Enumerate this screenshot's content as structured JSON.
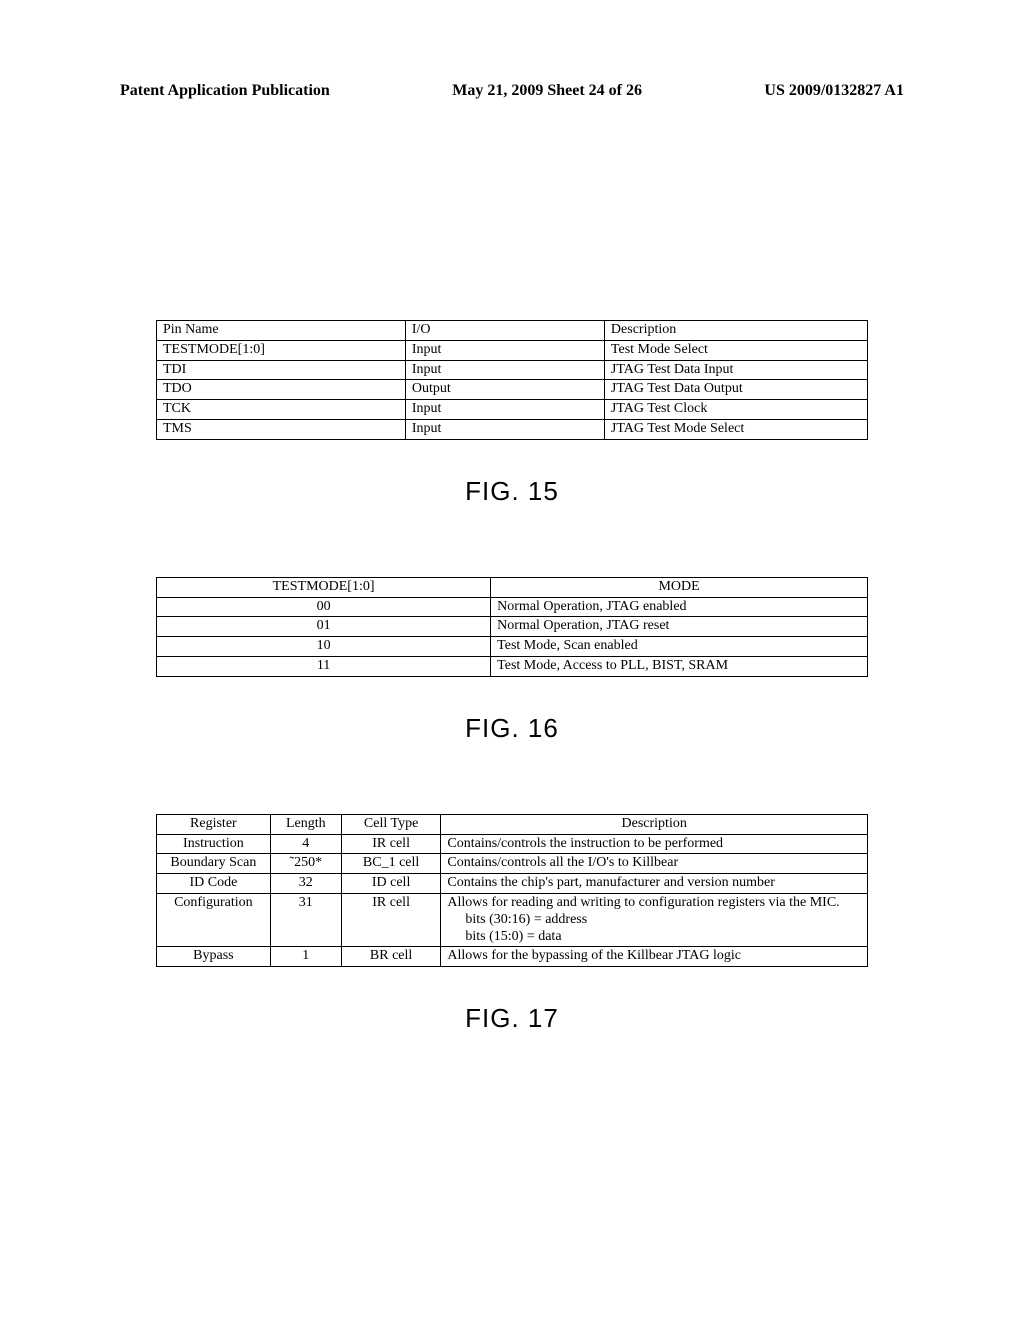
{
  "header": {
    "left": "Patent Application Publication",
    "mid": "May 21, 2009  Sheet 24 of 26",
    "right": "US 2009/0132827 A1"
  },
  "fig15": {
    "label": "FIG. 15",
    "headers": [
      "Pin Name",
      "I/O",
      "Description"
    ],
    "rows": [
      [
        "TESTMODE[1:0]",
        "Input",
        "Test Mode Select"
      ],
      [
        "TDI",
        "Input",
        "JTAG Test Data Input"
      ],
      [
        "TDO",
        "Output",
        "JTAG Test Data Output"
      ],
      [
        "TCK",
        "Input",
        "JTAG Test Clock"
      ],
      [
        "TMS",
        "Input",
        "JTAG Test Mode Select"
      ]
    ]
  },
  "fig16": {
    "label": "FIG. 16",
    "headers": [
      "TESTMODE[1:0]",
      "MODE"
    ],
    "rows": [
      [
        "00",
        "Normal Operation, JTAG enabled"
      ],
      [
        "01",
        "Normal Operation, JTAG reset"
      ],
      [
        "10",
        "Test Mode, Scan enabled"
      ],
      [
        "11",
        "Test Mode, Access to PLL, BIST, SRAM"
      ]
    ]
  },
  "fig17": {
    "label": "FIG. 17",
    "headers": [
      "Register",
      "Length",
      "Cell Type",
      "Description"
    ],
    "rows": [
      {
        "register": "Instruction",
        "length": "4",
        "cell_type": "IR cell",
        "description": "Contains/controls the instruction to be performed"
      },
      {
        "register": "Boundary Scan",
        "length": "˜250*",
        "cell_type": "BC_1 cell",
        "description": "Contains/controls all the I/O's to Killbear"
      },
      {
        "register": "ID Code",
        "length": "32",
        "cell_type": "ID cell",
        "description": "Contains the chip's part, manufacturer and version number"
      },
      {
        "register": "Configuration",
        "length": "31",
        "cell_type": "IR cell",
        "description": "Allows for reading and writing to configuration registers via the MIC.",
        "sub1": "bits (30:16) = address",
        "sub2": "bits (15:0)  = data"
      },
      {
        "register": "Bypass",
        "length": "1",
        "cell_type": "BR cell",
        "description": "Allows for the bypassing of the Killbear JTAG logic"
      }
    ]
  }
}
